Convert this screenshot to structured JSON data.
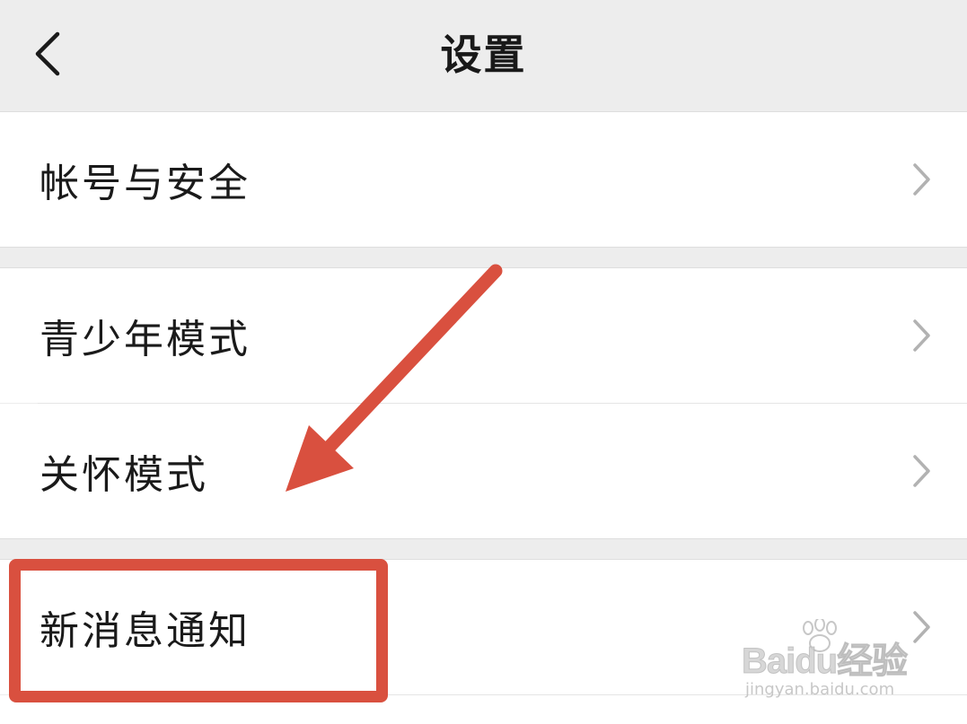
{
  "header": {
    "title": "设置",
    "back_icon": "chevron-left-icon"
  },
  "settings": {
    "items": [
      {
        "label": "帐号与安全",
        "icon": "chevron-right-icon"
      },
      {
        "label": "青少年模式",
        "icon": "chevron-right-icon"
      },
      {
        "label": "关怀模式",
        "icon": "chevron-right-icon"
      },
      {
        "label": "新消息通知",
        "icon": "chevron-right-icon"
      }
    ]
  },
  "annotation": {
    "arrow_color": "#d9503f",
    "highlight_color": "#d9503f",
    "highlighted_item": "新消息通知"
  },
  "watermark": {
    "brand": "Baidu经验",
    "url": "jingyan.baidu.com"
  },
  "colors": {
    "background": "#ededed",
    "row": "#ffffff",
    "text": "#1a1a1a",
    "chevron": "#b2b2b2"
  }
}
